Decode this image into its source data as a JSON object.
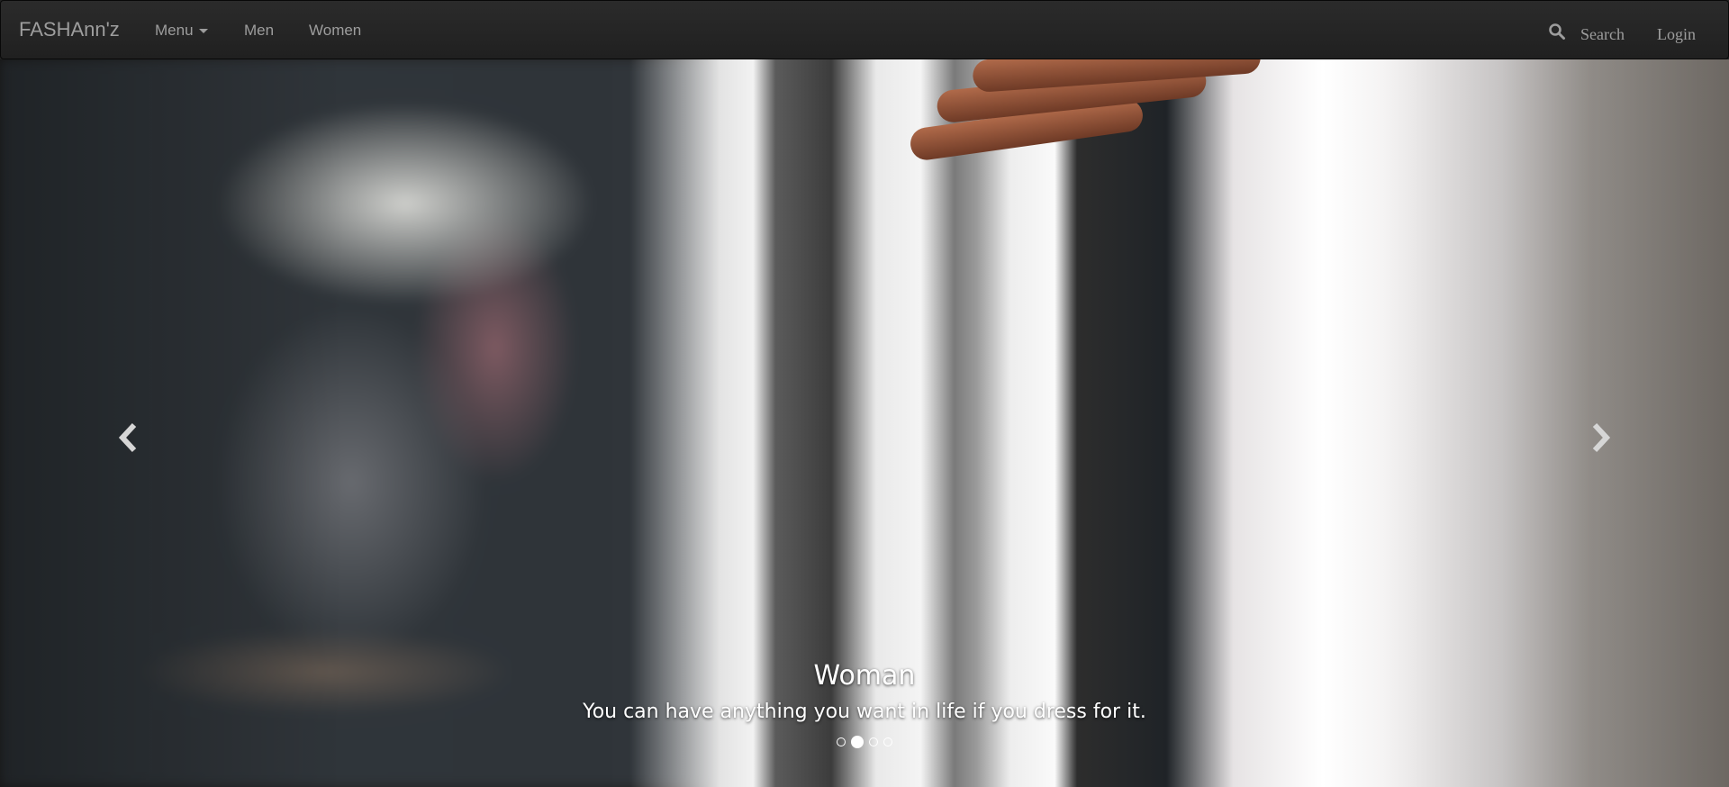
{
  "navbar": {
    "brand": "FASHAnn'z",
    "menu_label": "Menu",
    "links": [
      "Men",
      "Women"
    ],
    "search_label": "Search",
    "login_label": "Login"
  },
  "carousel": {
    "caption_title": "Woman",
    "caption_text": "You can have anything you want in life if you dress for it.",
    "slide_count": 4,
    "active_index": 1
  },
  "colors": {
    "navbar_bg": "#222222",
    "nav_text": "#9d9d9d",
    "caption_text": "#ffffff"
  },
  "icons": [
    "search-icon",
    "chevron-left-icon",
    "chevron-right-icon",
    "caret-down-icon"
  ]
}
